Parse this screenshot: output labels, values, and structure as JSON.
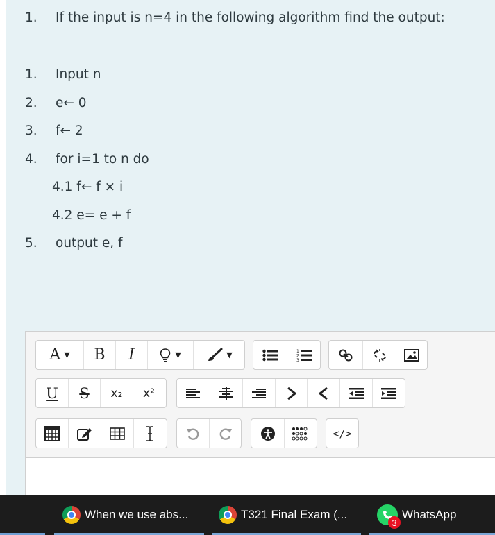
{
  "question": {
    "number": "1.",
    "text": "If the input is n=4 in the following algorithm find the output:"
  },
  "algorithm": [
    {
      "num": "1.",
      "text": "Input n"
    },
    {
      "num": "2.",
      "text": "e← 0"
    },
    {
      "num": "3.",
      "text": "f← 2"
    },
    {
      "num": "4.",
      "text": "for i=1 to n do"
    },
    {
      "num": "",
      "text": "4.1  f← f × i"
    },
    {
      "num": "",
      "text": "4.2  e= e + f"
    },
    {
      "num": "5.",
      "text": "output e, f"
    }
  ],
  "toolbar": {
    "font_label": "A",
    "bold_label": "B",
    "italic_label": "I",
    "underline_label": "U",
    "strike_label": "S",
    "subscript_label": "x₂",
    "superscript_label": "x²",
    "html_label": "</>"
  },
  "taskbar": {
    "items": [
      {
        "label": "When we use abs..."
      },
      {
        "label": "T321 Final Exam (..."
      },
      {
        "label": "WhatsApp",
        "badge": "3"
      }
    ]
  }
}
